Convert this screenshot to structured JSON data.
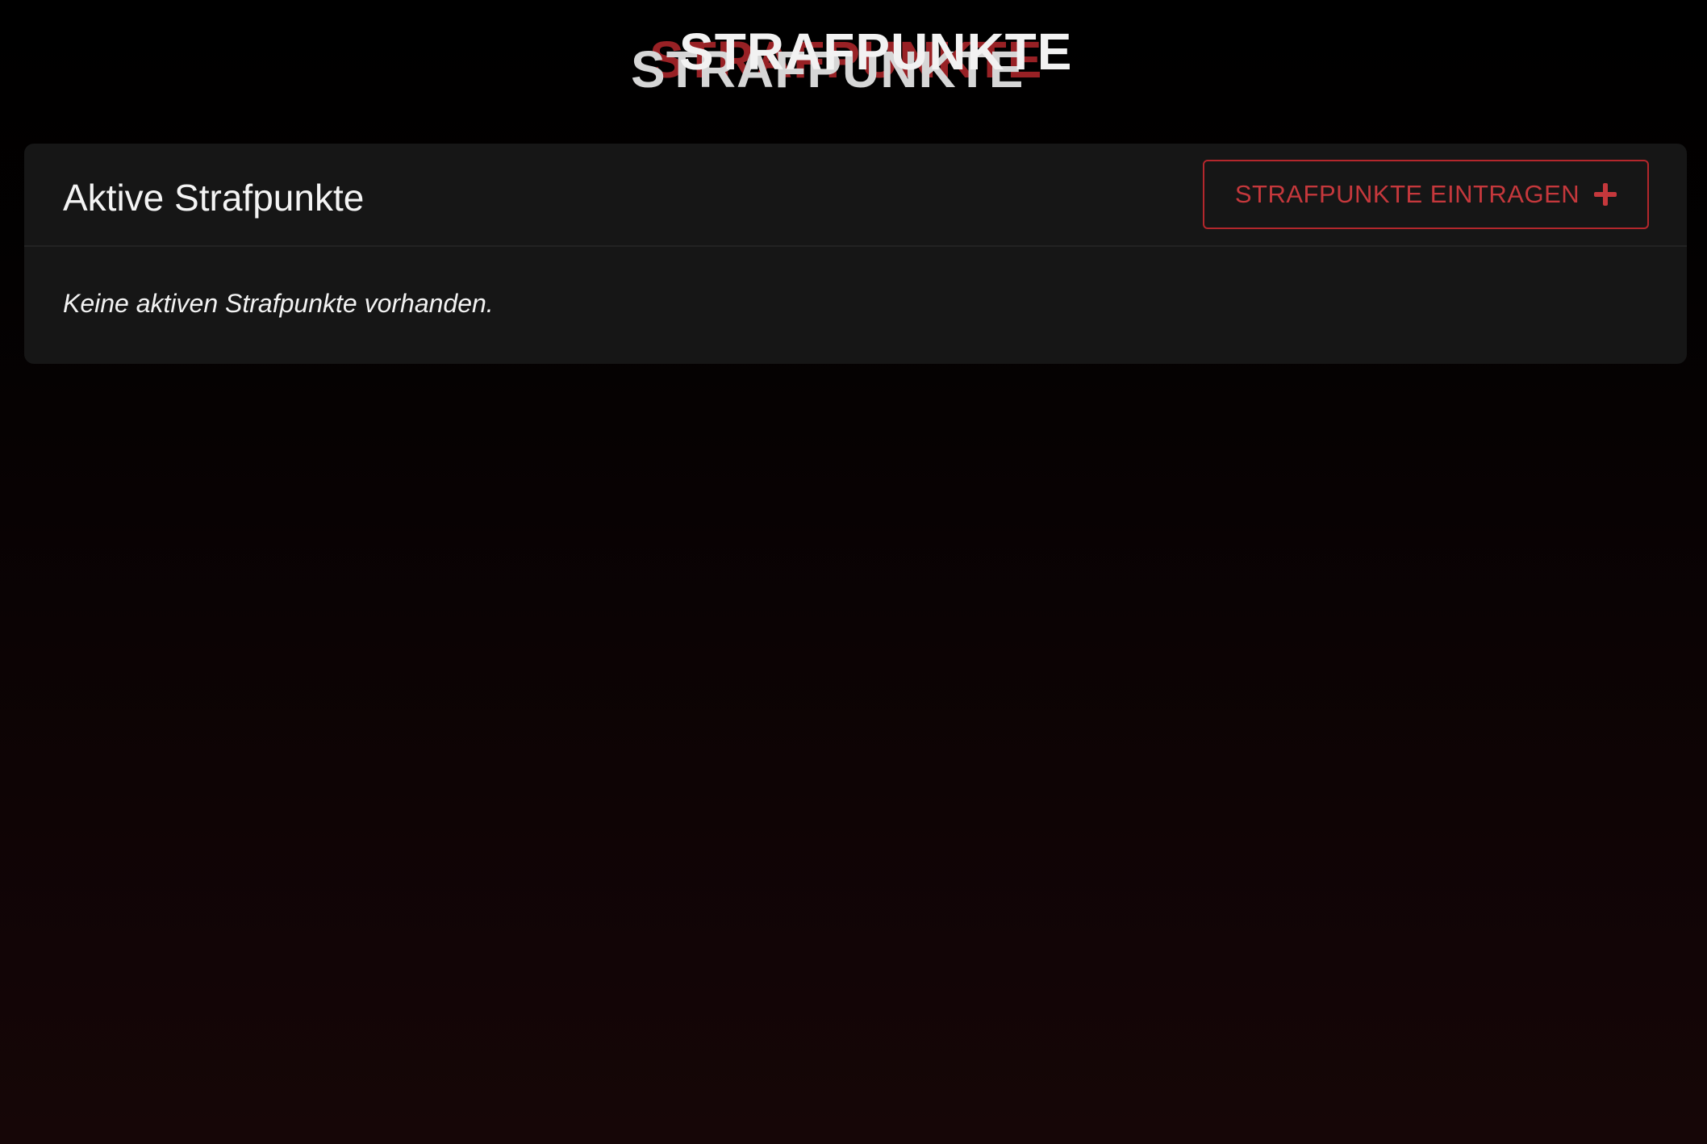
{
  "header": {
    "title": "STRAFPUNKTE"
  },
  "panel": {
    "title": "Aktive Strafpunkte",
    "add_button_label": "STRAFPUNKTE EINTRAGEN",
    "add_button_icon": "plus-icon",
    "empty_message": "Keine aktiven Strafpunkte vorhanden."
  },
  "colors": {
    "accent": "#b3272c",
    "panel_background": "#161616",
    "page_background_top": "#000000",
    "page_background_bottom": "#160607"
  }
}
